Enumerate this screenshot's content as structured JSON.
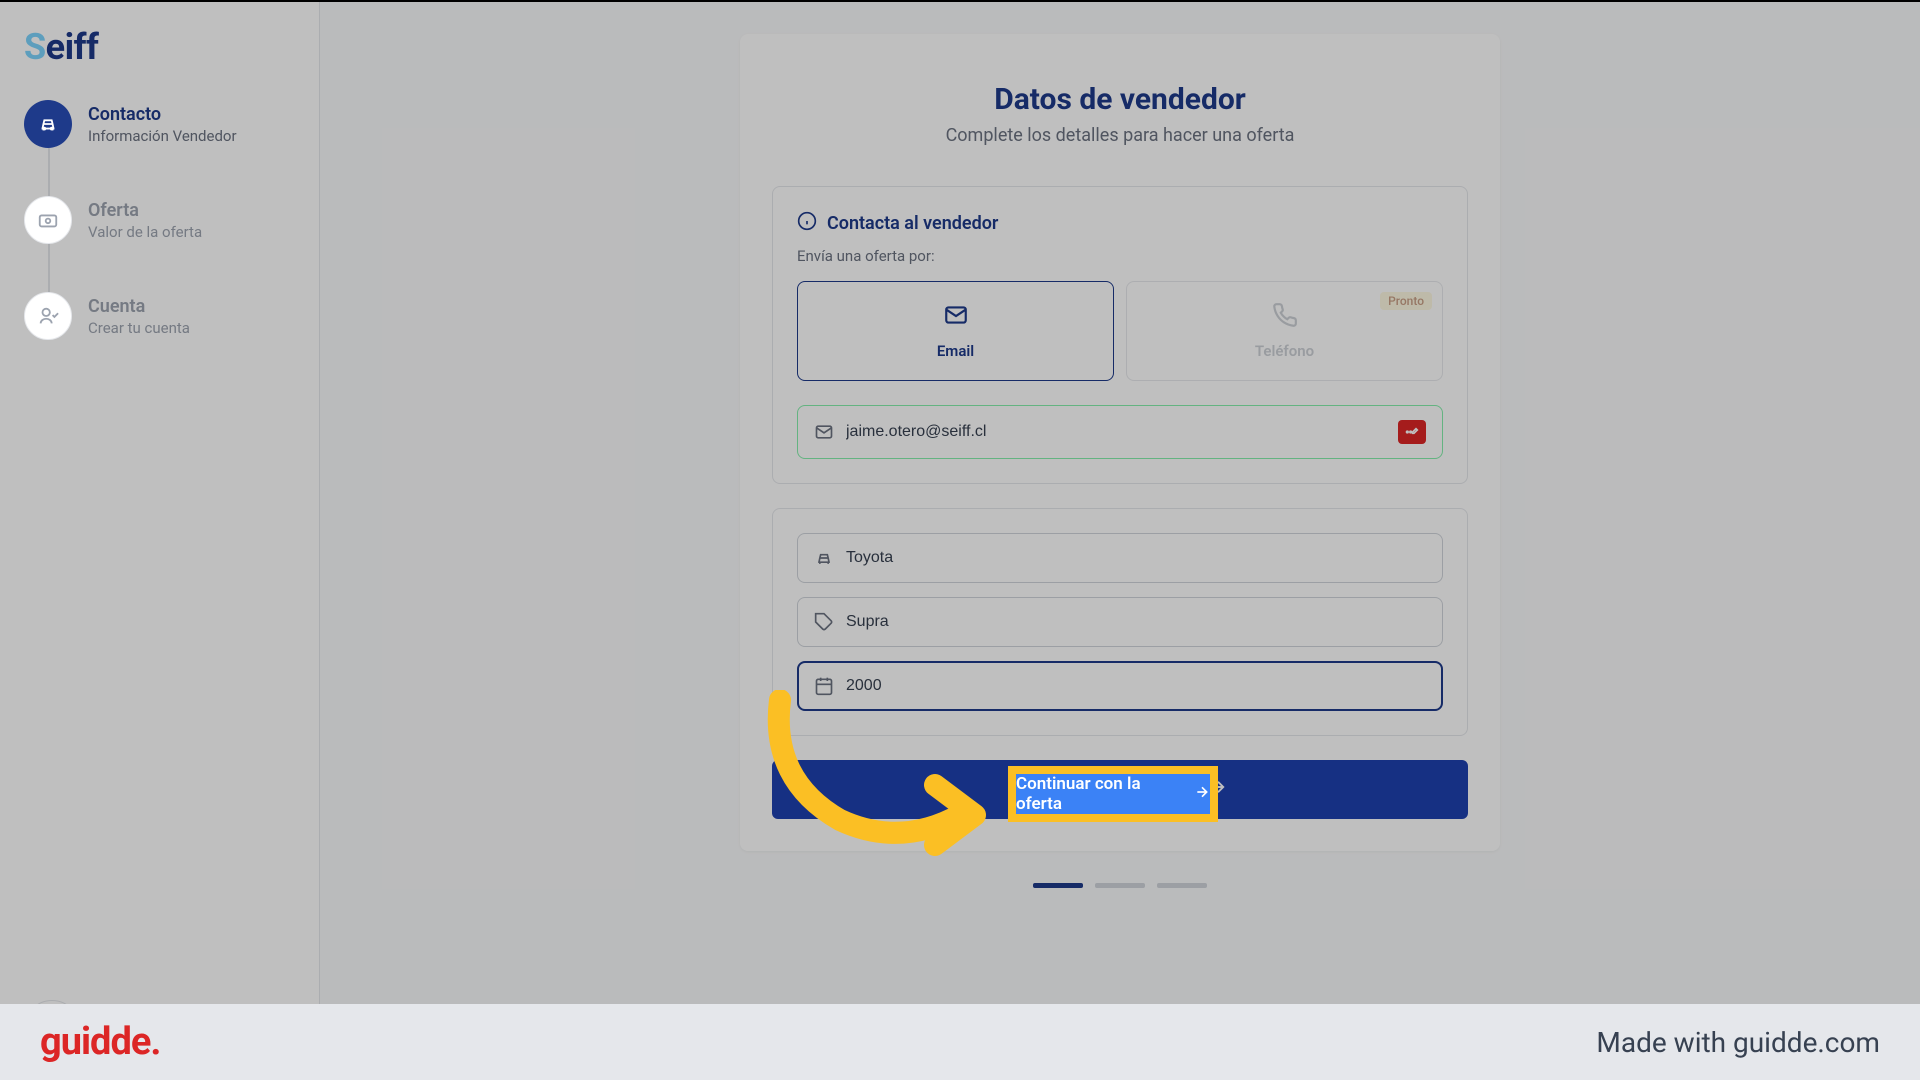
{
  "logo": {
    "text": "eiff"
  },
  "sidebar": {
    "steps": [
      {
        "title": "Contacto",
        "subtitle": "Información Vendedor"
      },
      {
        "title": "Oferta",
        "subtitle": "Valor de la oferta"
      },
      {
        "title": "Cuenta",
        "subtitle": "Crear tu cuenta"
      }
    ]
  },
  "form": {
    "title": "Datos de vendedor",
    "subtitle": "Complete los detalles para hacer una oferta",
    "contact_section": {
      "title": "Contacta al vendedor",
      "label": "Envía una oferta por:",
      "options": {
        "email": "Email",
        "phone": "Teléfono",
        "phone_badge": "Pronto"
      },
      "email_value": "jaime.otero@seiff.cl"
    },
    "vehicle": {
      "brand": "Toyota",
      "model": "Supra",
      "year": "2000"
    },
    "continue_button": "Continuar con la oferta"
  },
  "footer": {
    "logo": "guidde.",
    "text": "Made with guidde.com"
  },
  "highlight": {
    "button_text": "Continuar con la oferta"
  }
}
